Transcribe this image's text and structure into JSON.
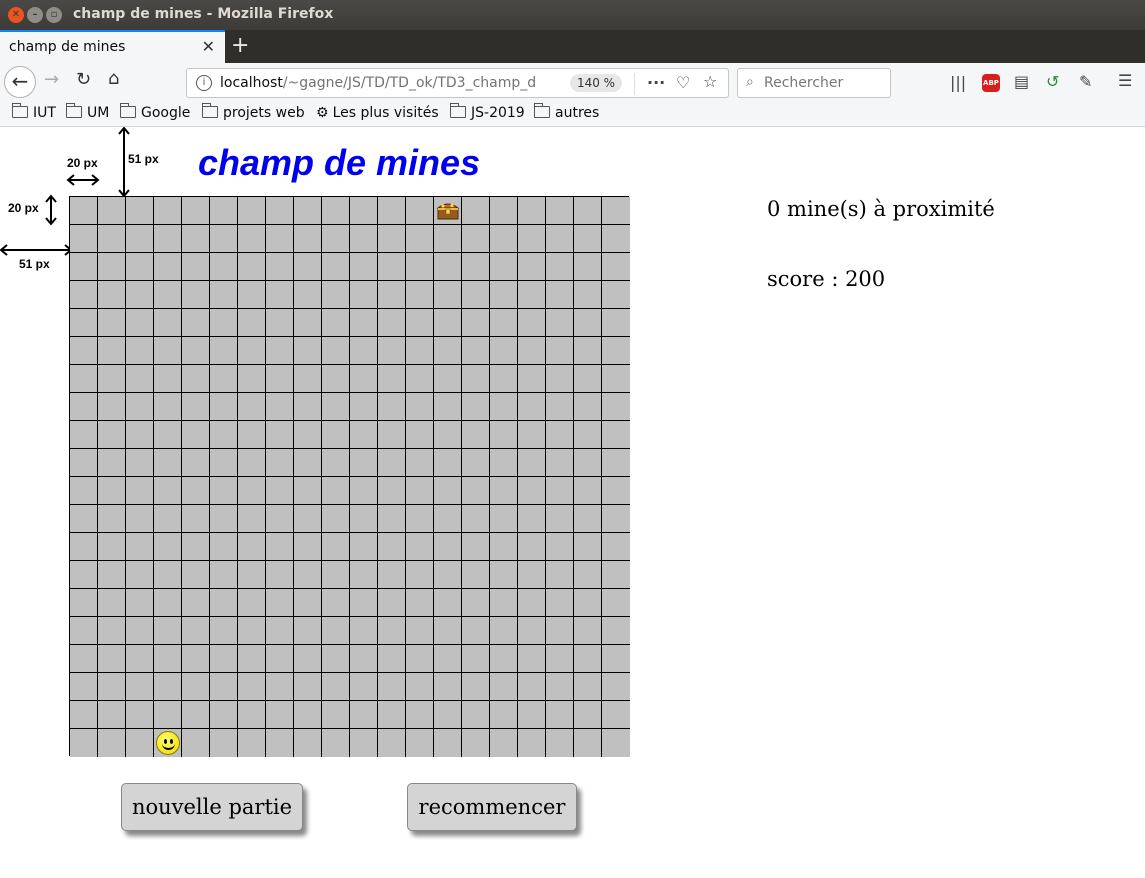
{
  "window": {
    "title": "champ de mines - Mozilla Firefox"
  },
  "tab": {
    "label": "champ de mines"
  },
  "nav": {
    "url_host": "localhost",
    "url_path": "/~gagne/JS/TD/TD_ok/TD3_champ_d",
    "zoom": "140 %",
    "search_placeholder": "Rechercher"
  },
  "bookmarks": [
    "IUT",
    "UM",
    "Google",
    "projets web",
    "Les plus visités",
    "JS-2019",
    "autres"
  ],
  "page": {
    "title": "champ de mines",
    "annotations": {
      "cell_width": "20 px",
      "cell_height": "20 px",
      "offset_top": "51 px",
      "offset_left": "51 px"
    },
    "proximity": "0 mine(s) à proximité",
    "score": "score : 200",
    "buttons": {
      "new_game": "nouvelle partie",
      "restart": "recommencer"
    }
  },
  "grid": {
    "rows": 20,
    "cols": 20,
    "treasure": {
      "row": 0,
      "col": 13
    },
    "player": {
      "row": 19,
      "col": 3
    }
  },
  "colors": {
    "cell": "#c0c0c0",
    "title": "#0000ee"
  }
}
